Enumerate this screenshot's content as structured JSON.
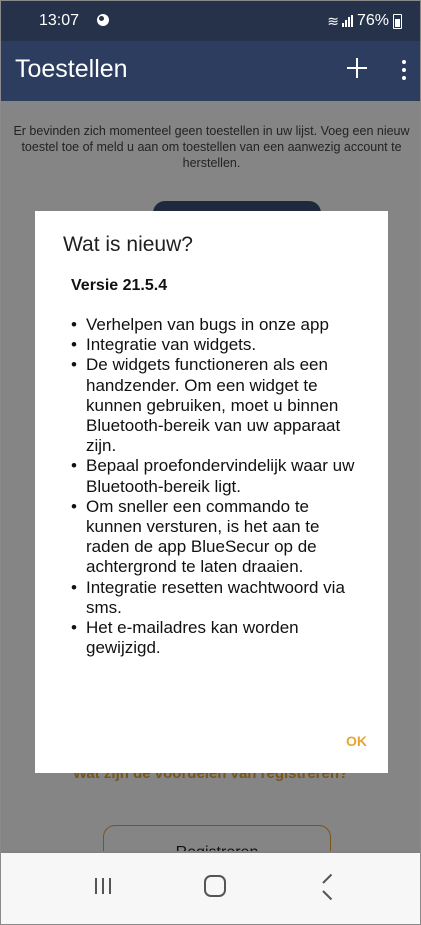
{
  "status_bar": {
    "time": "13:07",
    "battery": "76%",
    "icons": [
      "notification-circle-icon",
      "wifi-icon",
      "signal-icon",
      "battery-icon"
    ]
  },
  "app_bar": {
    "title": "Toestellen",
    "actions": [
      "add-icon",
      "more-vert-icon"
    ]
  },
  "background": {
    "empty_message": "Er bevinden zich momenteel geen toestellen in uw lijst. Voeg een nieuw toestel toe of meld u aan om toestellen van een aanwezig account te herstellen.",
    "benefits_link": "Wat zijn de voordelen van registreren?",
    "register_button": "Registreren"
  },
  "dialog": {
    "title": "Wat is nieuw?",
    "version": "Versie 21.5.4",
    "items": [
      "Verhelpen van bugs in onze app",
      "Integratie van widgets.",
      "De widgets functioneren als een handzender. Om een widget te kunnen gebruiken, moet u binnen Bluetooth-bereik van uw apparaat zijn.",
      "Bepaal proefondervindelijk waar uw Bluetooth-bereik ligt.",
      "Om sneller een commando te kunnen versturen, is het aan te raden de app BlueSecur op de achtergrond te laten draaien.",
      "Integratie resetten wachtwoord via sms.",
      "Het e-mailadres kan worden gewijzigd."
    ],
    "ok_label": "OK"
  },
  "nav_bar": {
    "buttons": [
      "recent-apps-icon",
      "home-icon",
      "back-icon"
    ]
  },
  "colors": {
    "status_bar": "#25324a",
    "app_bar": "#2c3d5f",
    "accent": "#e7a533",
    "scrim": "rgba(0,0,0,0.48)",
    "dialog": "#ffffff"
  }
}
